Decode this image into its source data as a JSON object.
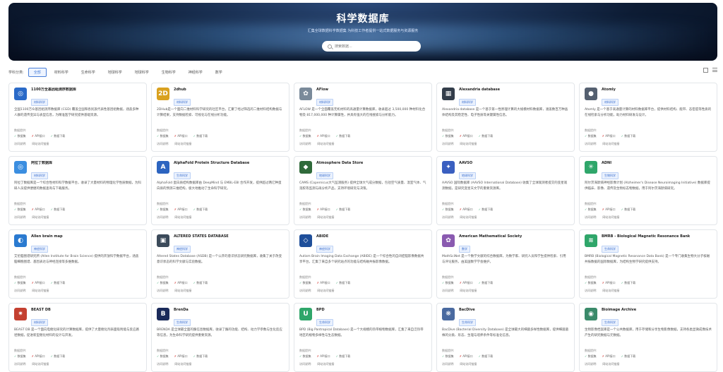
{
  "hero": {
    "title": "科学数据库",
    "subtitle": "汇集全球数据科学数据集 为科技工作者提供一站式数据服务与资源服务",
    "search_placeholder": "搜索数据..."
  },
  "filter": {
    "label": "学科分类:",
    "tabs": [
      "全部",
      "材料科学",
      "生命科学",
      "地球科学",
      "地球科学",
      "生物科学",
      "神经科学",
      "数学"
    ]
  },
  "card_common": {
    "meta_label": "数据提供:",
    "check1": "数据集",
    "check2": "API接口",
    "check3": "数据下载",
    "foot1": "访问说明:",
    "foot2": "网站访问链接"
  },
  "cards": [
    {
      "title": "1100万全基因组测序数据库",
      "tag": "材料科学",
      "logo_color": "#2a6ac8",
      "logo_char": "◎",
      "desc": "全国1100万众基因组测序数据库 (CGD) 覆盖全国和各民族代表性基因组数据，涵盖多种人群的遗传变异与表型信息，为精准医学研究提供基础资源。"
    },
    {
      "title": "2dhub",
      "tag": "材料科学",
      "logo_color": "#d9a11f",
      "logo_char": "2D",
      "desc": "2DHub是一个面向二维材料科学研究的社区平台，汇聚了经过筛选的二维材料结构数据与计算结果，支持数据检索、可视化与在线分析功能。"
    },
    {
      "title": "AFlow",
      "tag": "材料科学",
      "logo_color": "#7a8a9a",
      "logo_char": "✿",
      "desc": "AFLOW 是一个全面覆盖无机材料的高通量计算数据库，收录超过 3,500,000 种材料化合物及 817,000,000 种计算属性，并具有强大的在线搜索与分析能力。"
    },
    {
      "title": "Alexandria database",
      "tag": "材料科学",
      "logo_color": "#333d4a",
      "logo_char": "▦",
      "desc": "Alexandria database 是一个基于第一性原理计算的大规模材料数据库，涵盖数百万种晶体结构及其稳定性、电子性质等关键属性信息。"
    },
    {
      "title": "Atomly",
      "tag": "材料科学",
      "logo_color": "#556070",
      "logo_char": "●",
      "desc": "Atomly 是一个基于高通量计算的材料数据库平台，提供材料结构、能带、态密度等性质的在线检索与分析功能，助力材料研发与设计。"
    },
    {
      "title": "阿拉丁数据库",
      "tag": "材料科学",
      "logo_color": "#3b8ee0",
      "logo_char": "◎",
      "desc": "阿拉丁数据库是一个综合性材料科学数据平台，收录了大量材料的物理化学性质数据，为科研人员提供便捷的数据查询与下载服务。"
    },
    {
      "title": "AlphaFold Protein Structure Database",
      "tag": "生命科学",
      "logo_color": "#2c64c0",
      "logo_char": "A",
      "desc": "AlphaFold 蛋白质结构数据库由 DeepMind 与 EMBL-EBI 合作开发，提供超过两亿种蛋白质的预测三维结构，极大地推动了生命科学研究。"
    },
    {
      "title": "Atmosphere Data Store",
      "tag": "地球科学",
      "logo_color": "#2f6a3a",
      "logo_char": "◆",
      "desc": "CAMS (Copernicus大气监测服务) 提供全球大气成分数据，包括空气质量、温室气体、气溶胶等监测与再分析产品，支持环境研究与决策。"
    },
    {
      "title": "AAVSO",
      "tag": "地球科学",
      "logo_color": "#3a5fc0",
      "logo_char": "✦",
      "desc": "AAVSO 国际数据库 (AAVSO International Database) 收集了全球观测者提交的变星观测数据，是研究变星天文学的重要资源库。"
    },
    {
      "title": "ADNI",
      "tag": "生物科学",
      "logo_color": "#2fa66a",
      "logo_char": "✳",
      "desc": "阿尔茨海默病神经影像计划 (Alzheimer's Disease Neuroimaging Initiative) 数据库提供临床、影像、遗传及生物标志物数据，用于阿尔茨海默病研究。"
    },
    {
      "title": "Allen brain map",
      "tag": "神经科学",
      "logo_color": "#2a7ad0",
      "logo_char": "◐",
      "desc": "艾伦脑图谱研究所 (Allen Institute for Brain Science) 提供的开放科学数据平台，涵盖脑细胞图谱、基因表达与神经连接等多维数据。"
    },
    {
      "title": "ALTERED STATES DATABASE",
      "tag": "神经科学",
      "logo_color": "#3b4a5a",
      "logo_char": "▣",
      "desc": "Altered States Database (ASDB) 是一个公开的意识状态研究数据库，收集了关于改变意识状态的科学文献与实验数据。"
    },
    {
      "title": "ABIDE",
      "tag": "神经科学",
      "logo_color": "#1f4f9a",
      "logo_char": "◇",
      "desc": "Autism Brain Imaging Data Exchange (ABIDE) 是一个综合性的自闭症脑影像数据共享平台，汇集了来自多个研究站点的功能与结构磁共振影像数据。"
    },
    {
      "title": "American Mathematical Society",
      "tag": "数学",
      "logo_color": "#8a5ab0",
      "logo_char": "✿",
      "desc": "MathSciNet 是一个数学文献的综合数据库，为数学家、研究人员和学生提供检索、引用与评论服务，由美国数学学会维护。"
    },
    {
      "title": "BMRB - Biological Magnetic Resonance Bank",
      "tag": "生命科学",
      "logo_color": "#2fa66a",
      "logo_char": "≋",
      "desc": "BMRB (Biological Magnetic Resonance Data Bank) 是一个专门收集生物大分子核磁共振数据的国际数据库，为结构生物学研究提供支持。"
    },
    {
      "title": "BEAST DB",
      "tag": "材料科学",
      "logo_color": "#c44030",
      "logo_char": "✷",
      "desc": "BEAST DB 是一个面向电催化研究的计算数据库，提供了大量催化剂表面吸附能与反应路径数据，促进新型催化材料的设计与开发。"
    },
    {
      "title": "BrenDa",
      "tag": "生命科学",
      "logo_color": "#1a2a5a",
      "logo_char": "B",
      "desc": "BRENDA 是全球最全面的酶信息数据库，收录了酶的功能、结构、动力学参数与生化反应等信息，为生命科学研究提供重要资源。"
    },
    {
      "title": "BPD",
      "tag": "生命科学",
      "logo_color": "#2fa66a",
      "logo_char": "U",
      "desc": "BPD (Big Pantropical Database) 是一个大规模的热带植物数据库，汇集了来自泛热带地区的植物多样性与生态数据。"
    },
    {
      "title": "BacDive",
      "tag": "生命科学",
      "logo_color": "#4a6aa0",
      "logo_char": "❋",
      "desc": "BacDive (Bacterial Diversity Database) 是全球最大的细菌多样性数据库，提供细菌菌株的分类、形态、生理与培养条件等标准化信息。"
    },
    {
      "title": "Bioimage Archive",
      "tag": "生命科学",
      "logo_color": "#3a8a6a",
      "logo_char": "◉",
      "desc": "生物影像档案库是一个公共数据库，用于存储和分享生物影像数据，支持各类显微成像技术产生的研究数据与元数据。"
    }
  ]
}
